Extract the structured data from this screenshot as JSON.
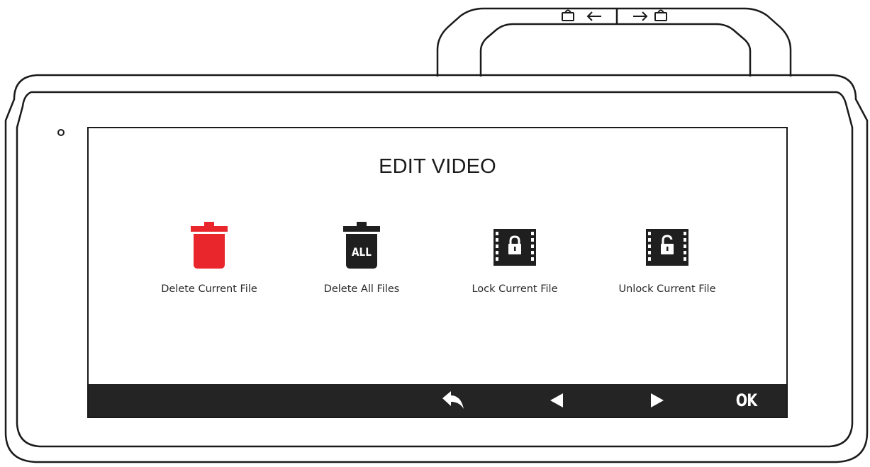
{
  "screen": {
    "title": "EDIT VIDEO"
  },
  "menu": {
    "items": [
      {
        "label": "Delete Current File",
        "icon": "red-trash-icon",
        "accent": "#e8262b"
      },
      {
        "label": "Delete All Files",
        "icon": "trash-all-icon",
        "badge": "ALL"
      },
      {
        "label": "Lock Current File",
        "icon": "film-lock-icon"
      },
      {
        "label": "Unlock Current File",
        "icon": "film-unlock-icon"
      }
    ]
  },
  "bottom_bar": {
    "back_icon": "return-arrow-icon",
    "left_icon": "triangle-left-icon",
    "right_icon": "triangle-right-icon",
    "ok_label": "OK"
  },
  "colors": {
    "bar_background": "#242424",
    "outline": "#1a1a1a",
    "delete_accent": "#e8262b"
  }
}
